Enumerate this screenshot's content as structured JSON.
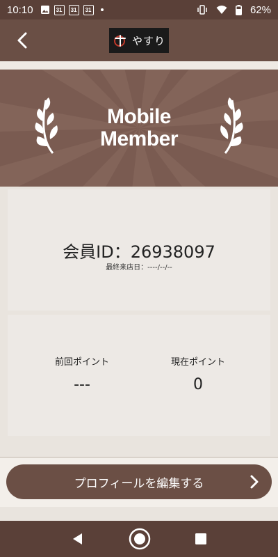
{
  "status_bar": {
    "time": "10:10",
    "calendar_days": [
      "31",
      "31",
      "31"
    ],
    "battery": "62%"
  },
  "header": {
    "logo_text": "やすり"
  },
  "banner": {
    "title_line1": "Mobile",
    "title_line2": "Member"
  },
  "member": {
    "id_text": "会員ID：26938097",
    "last_visit": "最終来店日：----/--/--"
  },
  "points": {
    "previous_label": "前回ポイント",
    "previous_value": "---",
    "current_label": "現在ポイント",
    "current_value": "0"
  },
  "actions": {
    "edit_profile_label": "プロフィールを編集する"
  },
  "colors": {
    "brand_brown": "#6b4f45",
    "banner_brown": "#7a5b51",
    "card_bg": "#ede9e5"
  },
  "icons": [
    "back-arrow-icon",
    "laurel-icon",
    "chevron-right-icon",
    "nav-back-icon",
    "nav-home-icon",
    "nav-recents-icon"
  ]
}
